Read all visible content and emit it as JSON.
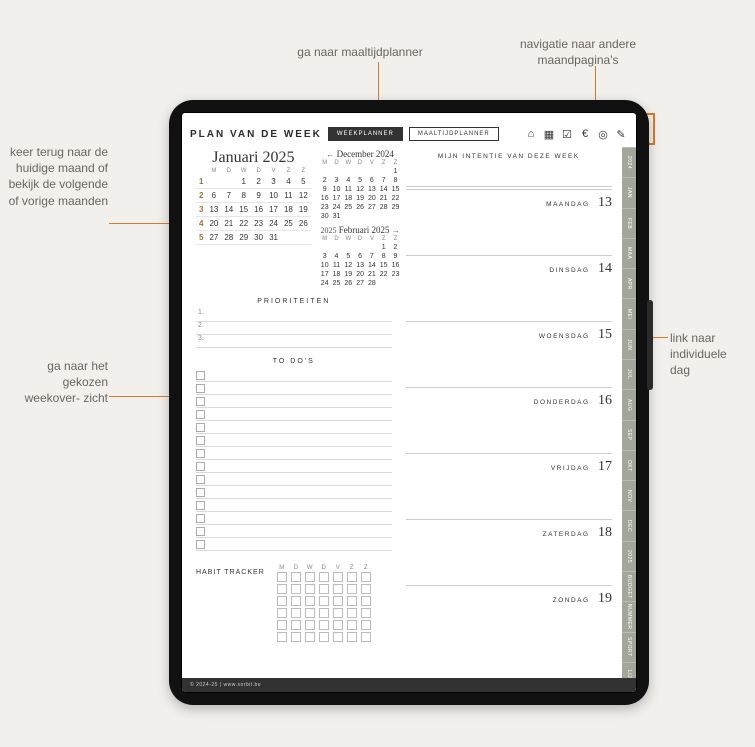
{
  "annotations": {
    "meal": "ga naar maaltijdplanner",
    "nav_months": "navigatie naar andere\nmaandpagina's",
    "back_month": "keer terug naar de huidige maand of bekijk de volgende of vorige maanden",
    "week_link": "ga naar het gekozen weekover-\nzicht",
    "day_link": "link naar individuele dag"
  },
  "planner": {
    "title": "PLAN VAN DE WEEK",
    "tabs": {
      "week": "WEEKPLANNER",
      "meal": "MAALTIJDPLANNER"
    },
    "icons": [
      "home",
      "calendar",
      "check",
      "euro",
      "target",
      "note"
    ],
    "month_tabs": [
      "2024",
      "JAN",
      "FEB",
      "MAA",
      "APR",
      "MEI",
      "JUN",
      "JUL",
      "AUG",
      "SEP",
      "OKT",
      "NOV",
      "DEC",
      "2025",
      "BUDGET",
      "NUMMER",
      "SPORT",
      "LIJST"
    ],
    "big_cal": {
      "label": "Januari 2025",
      "dow": [
        "M",
        "D",
        "W",
        "D",
        "V",
        "Z",
        "Z"
      ],
      "rows": [
        [
          "1",
          "",
          "",
          "1",
          "2",
          "3",
          "4",
          "5"
        ],
        [
          "2",
          "6",
          "7",
          "8",
          "9",
          "10",
          "11",
          "12"
        ],
        [
          "3",
          "13",
          "14",
          "15",
          "16",
          "17",
          "18",
          "19"
        ],
        [
          "4",
          "20",
          "21",
          "22",
          "23",
          "24",
          "25",
          "26"
        ],
        [
          "5",
          "27",
          "28",
          "29",
          "30",
          "31",
          "",
          ""
        ]
      ]
    },
    "prev_cal": {
      "label": "December 2024",
      "prefix": "←",
      "rows": [
        [
          "",
          "",
          "",
          "",
          "",
          "",
          "1"
        ],
        [
          "2",
          "3",
          "4",
          "5",
          "6",
          "7",
          "8"
        ],
        [
          "9",
          "10",
          "11",
          "12",
          "13",
          "14",
          "15"
        ],
        [
          "16",
          "17",
          "18",
          "19",
          "20",
          "21",
          "22"
        ],
        [
          "23",
          "24",
          "25",
          "26",
          "27",
          "28",
          "29"
        ],
        [
          "30",
          "31",
          "",
          "",
          "",
          "",
          ""
        ]
      ]
    },
    "next_cal": {
      "label": "Februari 2025",
      "prefix": "2025",
      "suffix": "→",
      "rows": [
        [
          "",
          "",
          "",
          "",
          "",
          "1",
          "2"
        ],
        [
          "3",
          "4",
          "5",
          "6",
          "7",
          "8",
          "9"
        ],
        [
          "10",
          "11",
          "12",
          "13",
          "14",
          "15",
          "16"
        ],
        [
          "17",
          "18",
          "19",
          "20",
          "21",
          "22",
          "23"
        ],
        [
          "24",
          "25",
          "26",
          "27",
          "28",
          "",
          ""
        ]
      ]
    },
    "priorities_title": "PRIORITEITEN",
    "priorities": [
      "1.",
      "2.",
      "3."
    ],
    "todos_title": "TO DO'S",
    "habit_title": "HABIT TRACKER",
    "habit_dow": [
      "M",
      "D",
      "W",
      "D",
      "V",
      "Z",
      "Z"
    ],
    "intent_title": "MIJN INTENTIE VAN DEZE WEEK",
    "days": [
      {
        "name": "MAANDAG",
        "num": "13"
      },
      {
        "name": "DINSDAG",
        "num": "14"
      },
      {
        "name": "WOENSDAG",
        "num": "15"
      },
      {
        "name": "DONDERDAG",
        "num": "16"
      },
      {
        "name": "VRIJDAG",
        "num": "17"
      },
      {
        "name": "ZATERDAG",
        "num": "18"
      },
      {
        "name": "ZONDAG",
        "num": "19"
      }
    ],
    "footer": "© 2024-25  |  www.sorbit.be"
  },
  "glyph": {
    "home": "⌂",
    "calendar": "▦",
    "check": "☑",
    "euro": "€",
    "target": "◎",
    "note": "✎"
  }
}
